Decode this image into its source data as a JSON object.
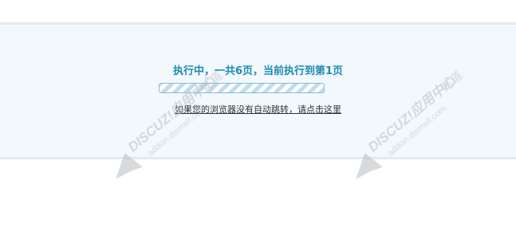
{
  "status": {
    "message": "执行中，一共6页，当前执行到第1页"
  },
  "progress": {
    "current_page": 1,
    "total_pages": 6,
    "fill_fraction": 1.0
  },
  "redirect": {
    "link_text": "如果您的浏览器没有自动跳转，请点击这里"
  },
  "watermark": {
    "brand_text": "DISCUZ!应用中心",
    "secondary_text": "贰道",
    "url_text": "addon.dismall.com",
    "icon": "discuz-plane-icon",
    "color": "#b9bfc4"
  },
  "colors": {
    "panel_background": "#f2f8fc",
    "panel_border": "#dfeaf4",
    "status_text": "#1f8bb2",
    "link_text": "#333333",
    "progress_border": "#8fb8d7",
    "progress_stripe": "#bfdcf1"
  }
}
